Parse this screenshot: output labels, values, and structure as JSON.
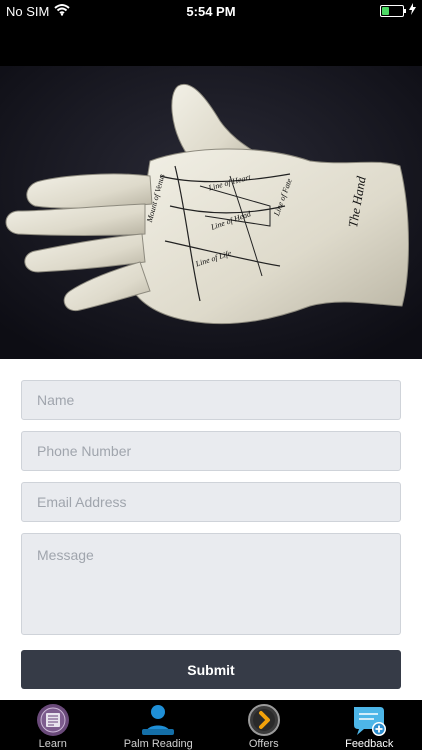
{
  "status_bar": {
    "carrier": "No SIM",
    "time": "5:54 PM",
    "battery_level": 0.35,
    "icons": [
      "wifi-icon",
      "battery-icon",
      "charging-icon"
    ]
  },
  "hero": {
    "image": "palmistry-hand-model-photo",
    "palm_text": {
      "title": "The Hand",
      "line_1": "Line of Heart",
      "line_2": "Line of Head",
      "line_3": "Line of Life",
      "line_4": "Line of Fate",
      "mount": "Mount of Venus"
    }
  },
  "form": {
    "name_placeholder": "Name",
    "phone_placeholder": "Phone Number",
    "email_placeholder": "Email Address",
    "message_placeholder": "Message",
    "submit_label": "Submit"
  },
  "tabs": [
    {
      "label": "Learn",
      "icon": "book-icon",
      "active": false
    },
    {
      "label": "Palm Reading",
      "icon": "palm-reader-icon",
      "active": false
    },
    {
      "label": "Offers",
      "icon": "chevron-right-icon",
      "active": false
    },
    {
      "label": "Feedback",
      "icon": "chat-bubble-plus-icon",
      "active": true
    }
  ],
  "colors": {
    "submit_bg": "#363b47",
    "field_bg": "#e9ebef",
    "tab_bar_bg": "#000000"
  }
}
